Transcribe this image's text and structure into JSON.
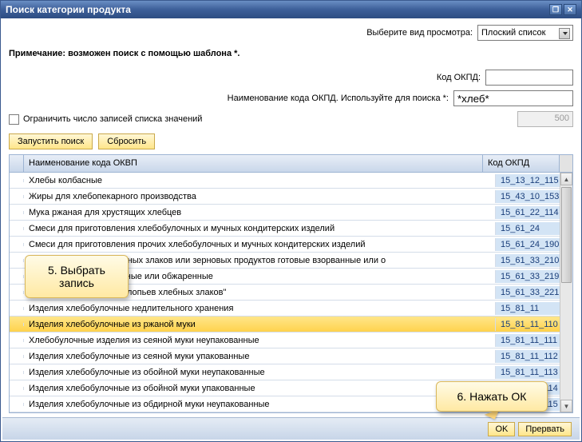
{
  "title": "Поиск категории продукта",
  "viewLabel": "Выберите вид просмотра:",
  "viewValue": "Плоский список",
  "note": "Примечание: возможен поиск с помощью шаблона *.",
  "codeLabel": "Код ОКПД:",
  "codeValue": "",
  "nameLabel": "Наименование кода ОКПД. Используйте для поиска *:",
  "nameValue": "*хлеб*",
  "limitLabel": "Ограничить число записей списка значений",
  "limitValue": "500",
  "runSearch": "Запустить поиск",
  "reset": "Сбросить",
  "thName": "Наименование кода ОКВП",
  "thCode": "Код ОКПД",
  "rows": [
    {
      "name": "Хлебы колбасные",
      "code": "15_13_12_115"
    },
    {
      "name": "Жиры для хлебопекарного производства",
      "code": "15_43_10_153"
    },
    {
      "name": "Мука ржаная для хрустящих хлебцев",
      "code": "15_61_22_114"
    },
    {
      "name": "Смеси для приготовления хлебобулочных и мучных кондитерских изделий",
      "code": "15_61_24"
    },
    {
      "name": "Смеси для приготовления прочих хлебобулочных и мучных кондитерских изделий",
      "code": "15_61_24_190"
    },
    {
      "name": "Продукты из зерна хлебных злаков или зерновых продуктов готовые взорванные или о",
      "code": "15_61_33_210"
    },
    {
      "name": "                                      злаков готовые взорванные или обжаренные",
      "code": "15_61_33_219"
    },
    {
      "name": "                                      основе необжаренных хлопьев хлебных злаков\"",
      "code": "15_61_33_221"
    },
    {
      "name": "Изделия хлебобулочные недлительного хранения",
      "code": "15_81_11"
    },
    {
      "name": "Изделия хлебобулочные из ржаной муки",
      "code": "15_81_11_110"
    },
    {
      "name": "Хлебобулочные изделия из сеяной муки неупакованные",
      "code": "15_81_11_111"
    },
    {
      "name": "Изделия хлебобулочные из сеяной муки упакованные",
      "code": "15_81_11_112"
    },
    {
      "name": "Изделия хлебобулочные из обойной муки неупакованные",
      "code": "15_81_11_113"
    },
    {
      "name": "Изделия хлебобулочные из обойной муки упакованные",
      "code": "15_81_11_114"
    },
    {
      "name": "Изделия хлебобулочные из обдирной муки неупакованные",
      "code": "15_81_11_115"
    }
  ],
  "selectedRow": 9,
  "ok": "OK",
  "cancel": "Прервать",
  "callout1a": "5. Выбрать",
  "callout1b": "запись",
  "callout2": "6. Нажать ОК"
}
